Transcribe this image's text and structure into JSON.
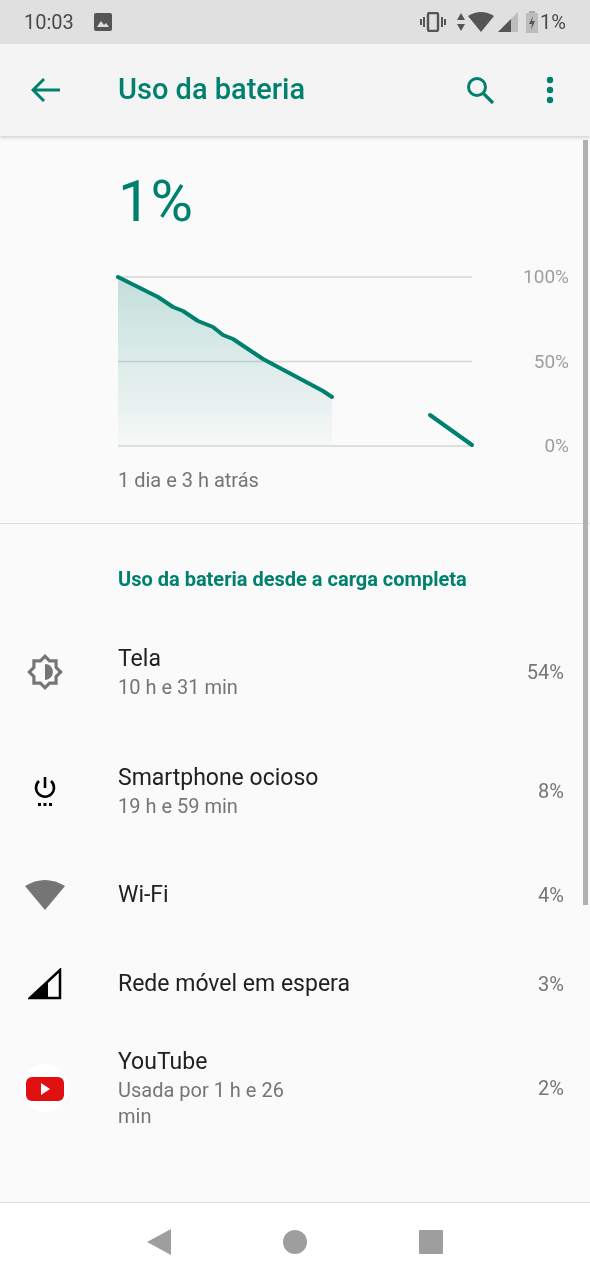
{
  "status_bar": {
    "time": "10:03",
    "battery": "1%"
  },
  "app_bar": {
    "title": "Uso da bateria"
  },
  "battery_level": "1%",
  "chart": {
    "axis_labels": [
      "100%",
      "50%",
      "0%"
    ]
  },
  "chart_caption": "1 dia e 3 h atrás",
  "section_header": "Uso da bateria desde a carga completa",
  "items": [
    {
      "kind": "screen",
      "title": "Tela",
      "subtitle": "10 h e 31 min",
      "percent": "54%"
    },
    {
      "kind": "idle",
      "title": "Smartphone ocioso",
      "subtitle": "19 h e 59 min",
      "percent": "8%"
    },
    {
      "kind": "wifi",
      "title": "Wi-Fi",
      "percent": "4%"
    },
    {
      "kind": "cell",
      "title": "Rede móvel em espera",
      "percent": "3%"
    },
    {
      "kind": "youtube",
      "title": "YouTube",
      "subtitle": "Usada por 1 h e 26 min",
      "percent": "2%"
    }
  ]
}
